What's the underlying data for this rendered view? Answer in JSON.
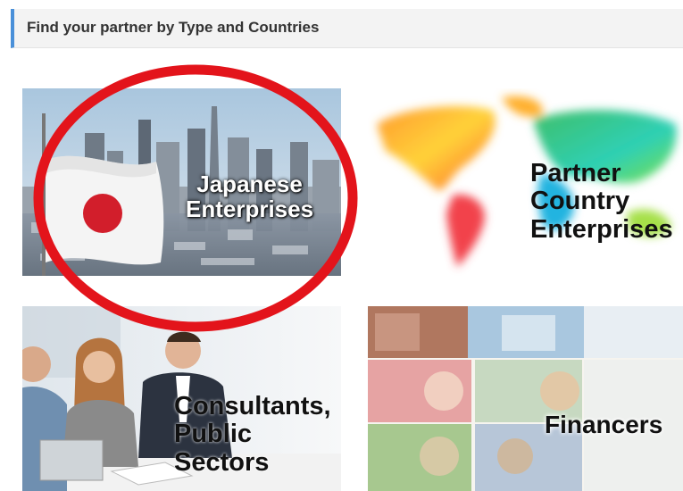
{
  "header": {
    "title": "Find your partner by Type and Countries"
  },
  "tiles": [
    {
      "lines": [
        "Japanese",
        "Enterprises"
      ]
    },
    {
      "lines": [
        "Partner",
        "Country",
        "Enterprises"
      ]
    },
    {
      "lines": [
        "Consultants,",
        "Public",
        "Sectors"
      ]
    },
    {
      "lines": [
        "Financers"
      ]
    }
  ],
  "colors": {
    "header_accent": "#4a90d9",
    "highlight_ring": "#e3141b"
  }
}
